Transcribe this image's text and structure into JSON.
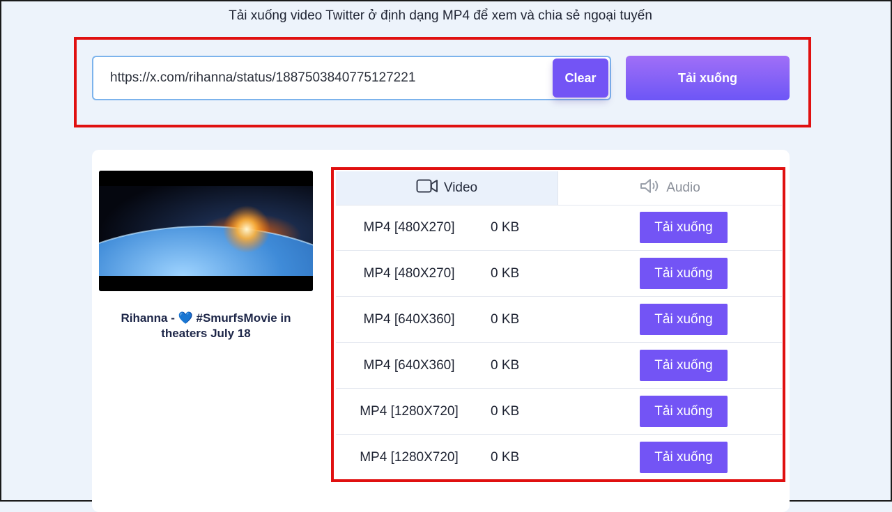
{
  "header": {
    "subtitle": "Tải xuống video Twitter ở định dạng MP4 để xem và chia sẻ ngoại tuyến"
  },
  "search": {
    "url_value": "https://x.com/rihanna/status/1887503840775127221",
    "clear_label": "Clear",
    "download_label": "Tải xuống"
  },
  "result": {
    "title_prefix": "Rihanna - ",
    "title_heart": "💙",
    "title_line1_rest": " #SmurfsMovie in",
    "title_line2": "theaters July 18",
    "tabs": {
      "video_label": "Video",
      "audio_label": "Audio",
      "active": "video"
    },
    "rows": [
      {
        "format": "MP4 [480X270]",
        "size": "0 KB",
        "button": "Tải xuống"
      },
      {
        "format": "MP4 [480X270]",
        "size": "0 KB",
        "button": "Tải xuống"
      },
      {
        "format": "MP4 [640X360]",
        "size": "0 KB",
        "button": "Tải xuống"
      },
      {
        "format": "MP4 [640X360]",
        "size": "0 KB",
        "button": "Tải xuống"
      },
      {
        "format": "MP4 [1280X720]",
        "size": "0 KB",
        "button": "Tải xuống"
      },
      {
        "format": "MP4 [1280X720]",
        "size": "0 KB",
        "button": "Tải xuống"
      }
    ]
  },
  "colors": {
    "accent": "#7354f5",
    "highlight": "#e01010",
    "background": "#edf3fb"
  },
  "icons": {
    "video_tab": "video-camera-icon",
    "audio_tab": "speaker-icon"
  }
}
